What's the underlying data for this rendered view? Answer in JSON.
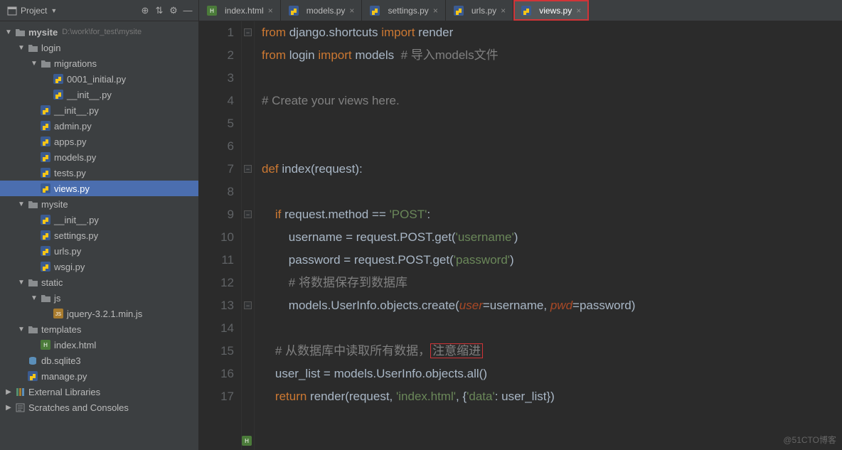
{
  "sidebar": {
    "title": "Project",
    "project_root": "mysite",
    "project_path": "D:\\work\\for_test\\mysite",
    "tree": [
      {
        "name": "login",
        "icon": "folder",
        "indent": 1,
        "exp": true
      },
      {
        "name": "migrations",
        "icon": "folder",
        "indent": 2,
        "exp": true
      },
      {
        "name": "0001_initial.py",
        "icon": "py",
        "indent": 3
      },
      {
        "name": "__init__.py",
        "icon": "py",
        "indent": 3
      },
      {
        "name": "__init__.py",
        "icon": "py",
        "indent": 2
      },
      {
        "name": "admin.py",
        "icon": "py",
        "indent": 2
      },
      {
        "name": "apps.py",
        "icon": "py",
        "indent": 2
      },
      {
        "name": "models.py",
        "icon": "py",
        "indent": 2
      },
      {
        "name": "tests.py",
        "icon": "py",
        "indent": 2
      },
      {
        "name": "views.py",
        "icon": "py",
        "indent": 2,
        "sel": true
      },
      {
        "name": "mysite",
        "icon": "folder",
        "indent": 1,
        "exp": true
      },
      {
        "name": "__init__.py",
        "icon": "py",
        "indent": 2
      },
      {
        "name": "settings.py",
        "icon": "py",
        "indent": 2
      },
      {
        "name": "urls.py",
        "icon": "py",
        "indent": 2
      },
      {
        "name": "wsgi.py",
        "icon": "py",
        "indent": 2
      },
      {
        "name": "static",
        "icon": "folder",
        "indent": 1,
        "exp": true
      },
      {
        "name": "js",
        "icon": "folder",
        "indent": 2,
        "exp": true
      },
      {
        "name": "jquery-3.2.1.min.js",
        "icon": "js",
        "indent": 3
      },
      {
        "name": "templates",
        "icon": "folder",
        "indent": 1,
        "exp": true
      },
      {
        "name": "index.html",
        "icon": "html",
        "indent": 2
      },
      {
        "name": "db.sqlite3",
        "icon": "db",
        "indent": 1
      },
      {
        "name": "manage.py",
        "icon": "py",
        "indent": 1
      }
    ],
    "extra": [
      {
        "name": "External Libraries",
        "icon": "lib"
      },
      {
        "name": "Scratches and Consoles",
        "icon": "scratch"
      }
    ]
  },
  "tabs": [
    {
      "label": "index.html",
      "icon": "html"
    },
    {
      "label": "models.py",
      "icon": "py"
    },
    {
      "label": "settings.py",
      "icon": "py"
    },
    {
      "label": "urls.py",
      "icon": "py"
    },
    {
      "label": "views.py",
      "icon": "py",
      "active": true,
      "highlighted": true
    }
  ],
  "code": {
    "line_count": 17,
    "lines": [
      {
        "n": 1,
        "html": "<span class='k'>from</span> django.shortcuts <span class='k'>import</span> render"
      },
      {
        "n": 2,
        "html": "<span class='k'>from</span> login <span class='k'>import</span> models  <span class='c'># 导入models文件</span>"
      },
      {
        "n": 3,
        "html": ""
      },
      {
        "n": 4,
        "html": "<span class='c'># Create your views here.</span>"
      },
      {
        "n": 5,
        "html": ""
      },
      {
        "n": 6,
        "html": ""
      },
      {
        "n": 7,
        "html": "<span class='k'>def </span><span class='n'>index</span>(request):"
      },
      {
        "n": 8,
        "html": ""
      },
      {
        "n": 9,
        "html": "    <span class='k'>if</span> request.method == <span class='s'>'POST'</span>:"
      },
      {
        "n": 10,
        "html": "        username = request.POST.get(<span class='s'>'username'</span>)"
      },
      {
        "n": 11,
        "html": "        password = request.POST.get(<span class='s'>'password'</span>)"
      },
      {
        "n": 12,
        "html": "        <span class='c'># 将数据保存到数据库</span>"
      },
      {
        "n": 13,
        "html": "        models.UserInfo.objects.create(<span class='kw-arg'>user</span>=username, <span class='kw-arg'>pwd</span>=password)"
      },
      {
        "n": 14,
        "html": ""
      },
      {
        "n": 15,
        "html": "    <span class='c'># 从数据库中读取所有数据，<span class='hl-box'>注意缩进</span></span>"
      },
      {
        "n": 16,
        "html": "    user_list = models.UserInfo.objects.all()"
      },
      {
        "n": 17,
        "html": "    <span class='k'>return</span> render(request, <span class='s'>'index.html'</span>, {<span class='s'>'data'</span>: user_list})"
      }
    ],
    "fold_marks": [
      1,
      7,
      9,
      13
    ]
  },
  "watermark": "@51CTO博客"
}
